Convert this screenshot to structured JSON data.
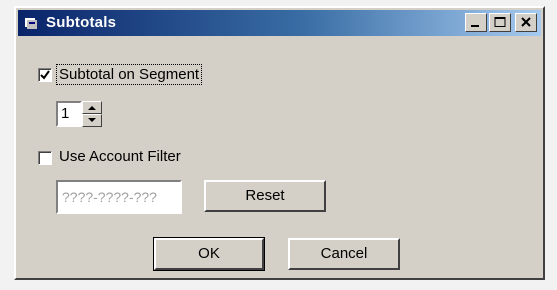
{
  "window": {
    "title": "Subtotals",
    "controls": [
      "minimize-icon",
      "maximize-icon",
      "close-icon"
    ]
  },
  "subtotal_on_segment": {
    "label": "Subtotal on Segment",
    "checked": true
  },
  "segment_spinner": {
    "value": "1"
  },
  "use_account_filter": {
    "label": "Use Account Filter",
    "checked": false
  },
  "account_filter": {
    "value": "????-????-???"
  },
  "buttons": {
    "reset": "Reset",
    "ok": "OK",
    "cancel": "Cancel"
  }
}
